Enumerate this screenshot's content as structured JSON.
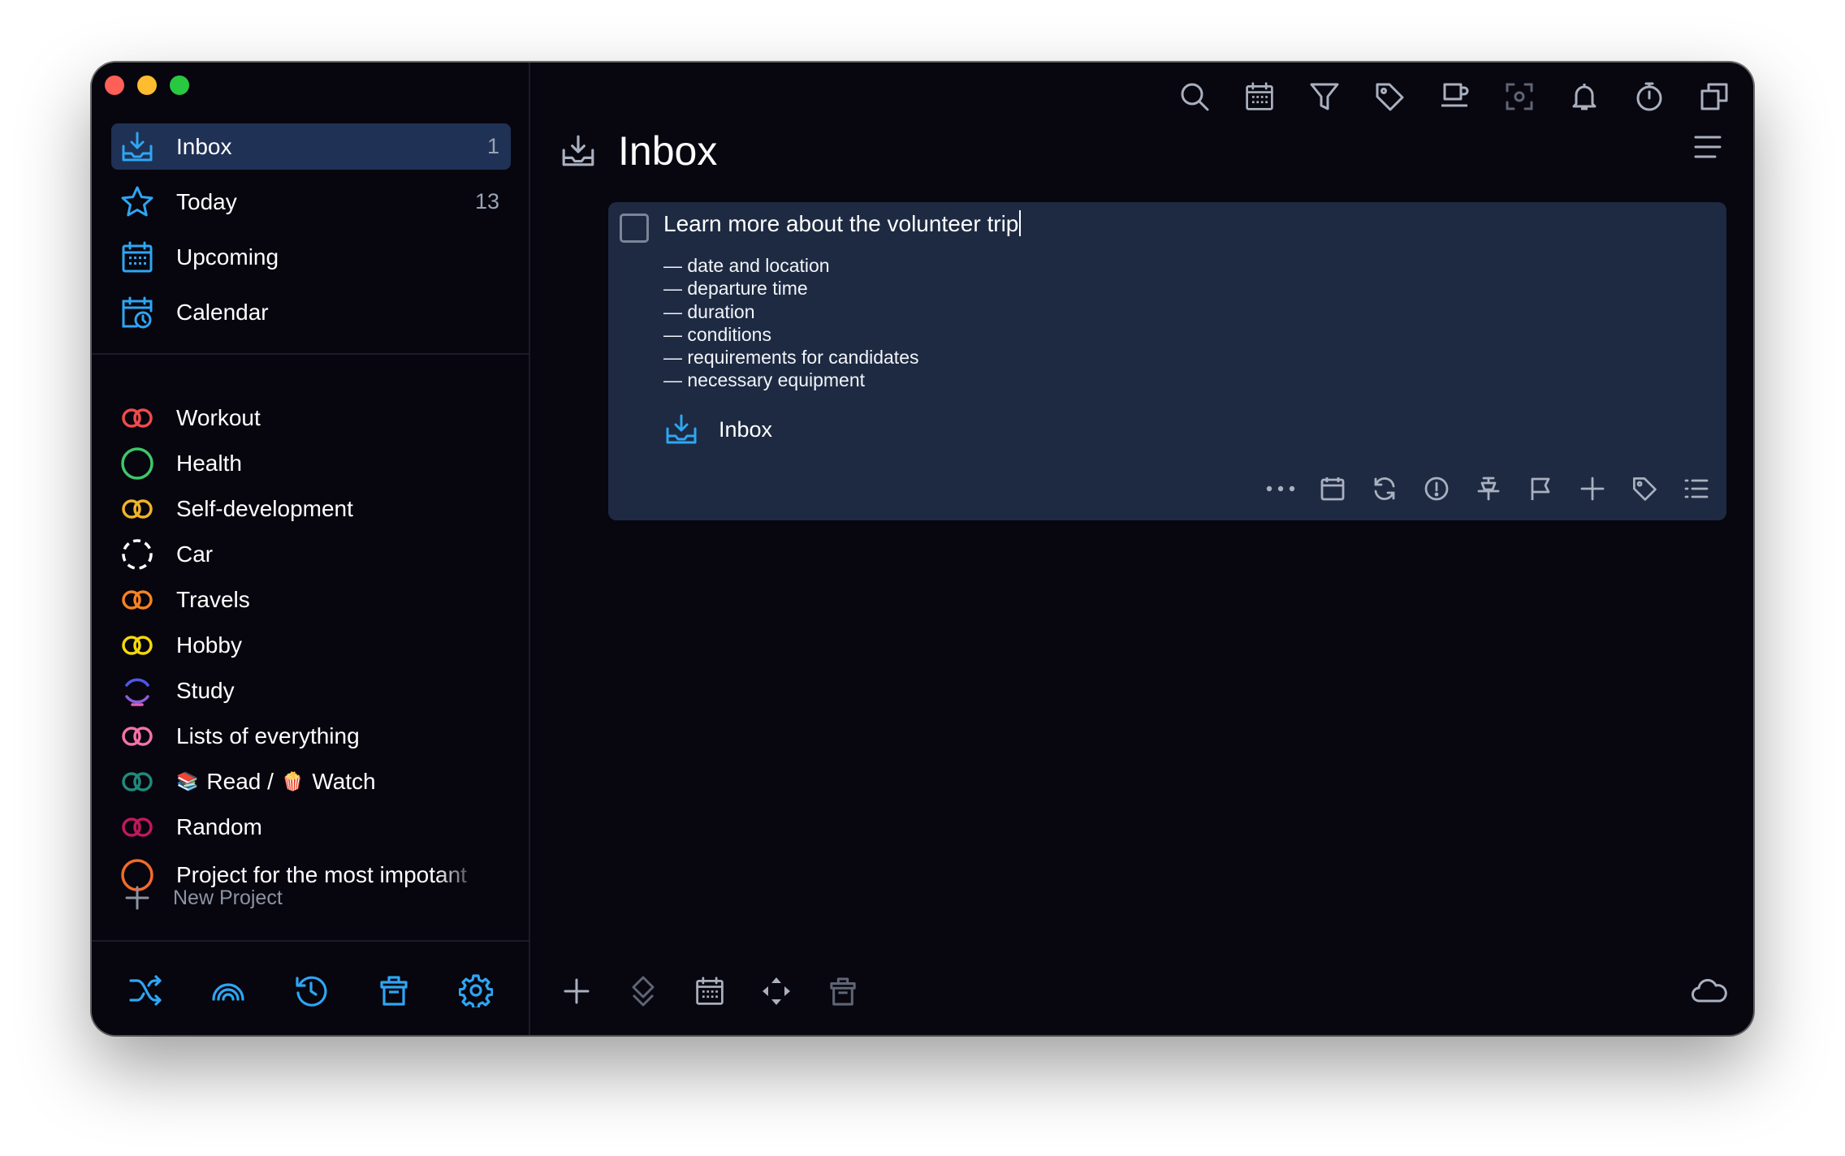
{
  "colors": {
    "accent": "#2ea6f3",
    "window_bg": "#08060f",
    "active_row": "#1f3155",
    "card_bg": "#1d2a42"
  },
  "sidebar": {
    "nav": [
      {
        "label": "Inbox",
        "count": "1",
        "icon": "inbox-icon"
      },
      {
        "label": "Today",
        "count": "13",
        "icon": "star-icon"
      },
      {
        "label": "Upcoming",
        "count": "",
        "icon": "calendar-grid-icon"
      },
      {
        "label": "Calendar",
        "count": "",
        "icon": "calendar-clock-icon"
      }
    ],
    "projects": [
      {
        "label": "Workout",
        "icon": "double-ring-icon",
        "color": "#f04b4b"
      },
      {
        "label": "Health",
        "icon": "circle-icon",
        "color": "#3cc76a"
      },
      {
        "label": "Self-development",
        "icon": "double-ring-icon",
        "color": "#f0b429"
      },
      {
        "label": "Car",
        "icon": "dashed-circle-icon",
        "color": "#ffffff"
      },
      {
        "label": "Travels",
        "icon": "double-ring-icon",
        "color": "#f58220"
      },
      {
        "label": "Hobby",
        "icon": "double-ring-icon",
        "color": "#f5d90a"
      },
      {
        "label": "Study",
        "icon": "partial-circle-icon",
        "color": "#4f57e8"
      },
      {
        "label": "Lists of everything",
        "icon": "double-ring-icon",
        "color": "#f472a8"
      },
      {
        "label_a": "Read /",
        "label_b": "Watch",
        "icon": "double-ring-icon",
        "color": "#1f8a7a"
      },
      {
        "label": "Random",
        "icon": "double-ring-icon",
        "color": "#c2185b"
      },
      {
        "label": "Project for the most impotant",
        "icon": "circle-icon",
        "color": "#f26b2a"
      }
    ],
    "new_project": "New Project",
    "bottom_icons": [
      "shuffle-icon",
      "rainbow-icon",
      "history-icon",
      "trash-icon",
      "settings-icon"
    ]
  },
  "header": {
    "title": "Inbox",
    "toolbar_icons": [
      "search-icon",
      "calendar-grid-icon",
      "filter-icon",
      "tag-icon",
      "coffee-icon",
      "focus-icon",
      "bell-icon",
      "timer-icon",
      "copy-icon"
    ]
  },
  "task": {
    "title": "Learn more about the volunteer trip",
    "notes": [
      "date and location",
      "departure time",
      "duration",
      "conditions",
      "requirements for candidates",
      "necessary equipment"
    ],
    "project": "Inbox",
    "tool_icons": [
      "more-icon",
      "date-icon",
      "repeat-icon",
      "priority-icon",
      "pin-icon",
      "flag-icon",
      "subtask-icon",
      "tag-icon",
      "checklist-icon"
    ]
  },
  "footer": {
    "icons": [
      "add-icon",
      "reorder-icon",
      "calendar-icon",
      "move-icon",
      "trash-icon",
      "cloud-icon"
    ]
  }
}
